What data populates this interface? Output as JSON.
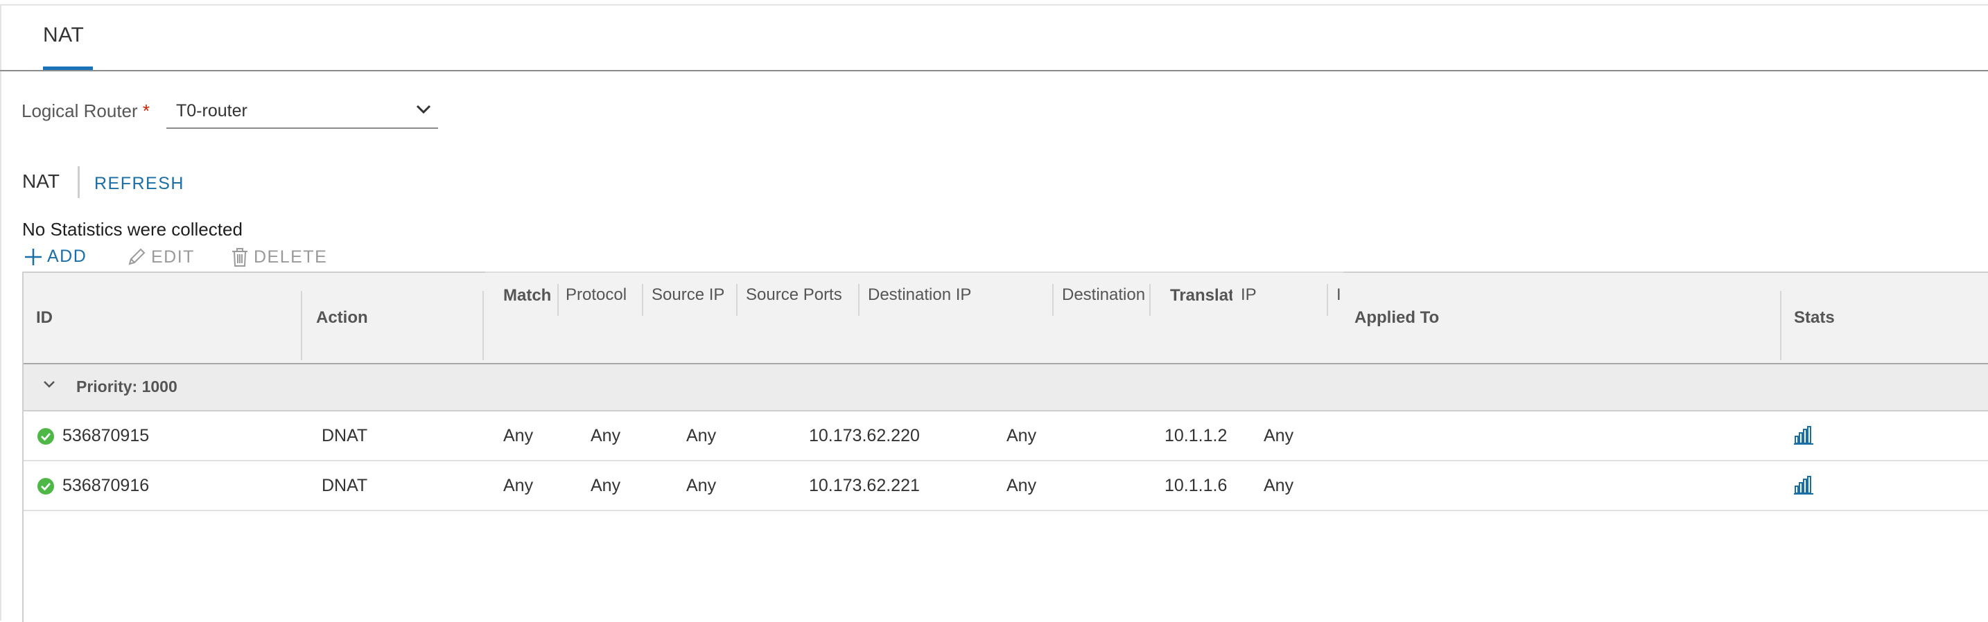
{
  "tabs": {
    "active": "NAT"
  },
  "logical_router": {
    "label": "Logical Router",
    "required_mark": "*",
    "value": "T0-router"
  },
  "section": {
    "title": "NAT",
    "refresh": "REFRESH"
  },
  "stats_message": "No Statistics were collected",
  "toolbar": {
    "add": "ADD",
    "edit": "EDIT",
    "delete": "DELETE"
  },
  "table": {
    "headers": {
      "id": "ID",
      "action": "Action",
      "match": "Match",
      "protocol": "Protocol",
      "source_ip": "Source IP",
      "source_ports": "Source Ports",
      "destination_ip": "Destination IP",
      "destination_ports": "Destination",
      "translated": "Translat",
      "translated_ip": "IP",
      "translated_ports": "I",
      "applied_to": "Applied To",
      "stats": "Stats"
    },
    "group": {
      "label": "Priority: 1000"
    },
    "rows": [
      {
        "id": "536870915",
        "action": "DNAT",
        "protocol": "Any",
        "source_ip": "Any",
        "source_ports": "Any",
        "destination_ip": "10.173.62.220",
        "destination_ports": "Any",
        "translated_ip": "10.1.1.2",
        "translated_ports": "Any"
      },
      {
        "id": "536870916",
        "action": "DNAT",
        "protocol": "Any",
        "source_ip": "Any",
        "source_ports": "Any",
        "destination_ip": "10.173.62.221",
        "destination_ports": "Any",
        "translated_ip": "10.1.1.6",
        "translated_ports": "Any"
      }
    ]
  },
  "colors": {
    "accent": "#1a6fa6",
    "success": "#4eb847",
    "required": "#c92100"
  },
  "icons": {
    "status": "check-circle-icon",
    "stats": "bar-chart-icon",
    "add": "plus-icon",
    "edit": "pencil-icon",
    "delete": "trash-icon",
    "group": "chevron-down-icon"
  }
}
